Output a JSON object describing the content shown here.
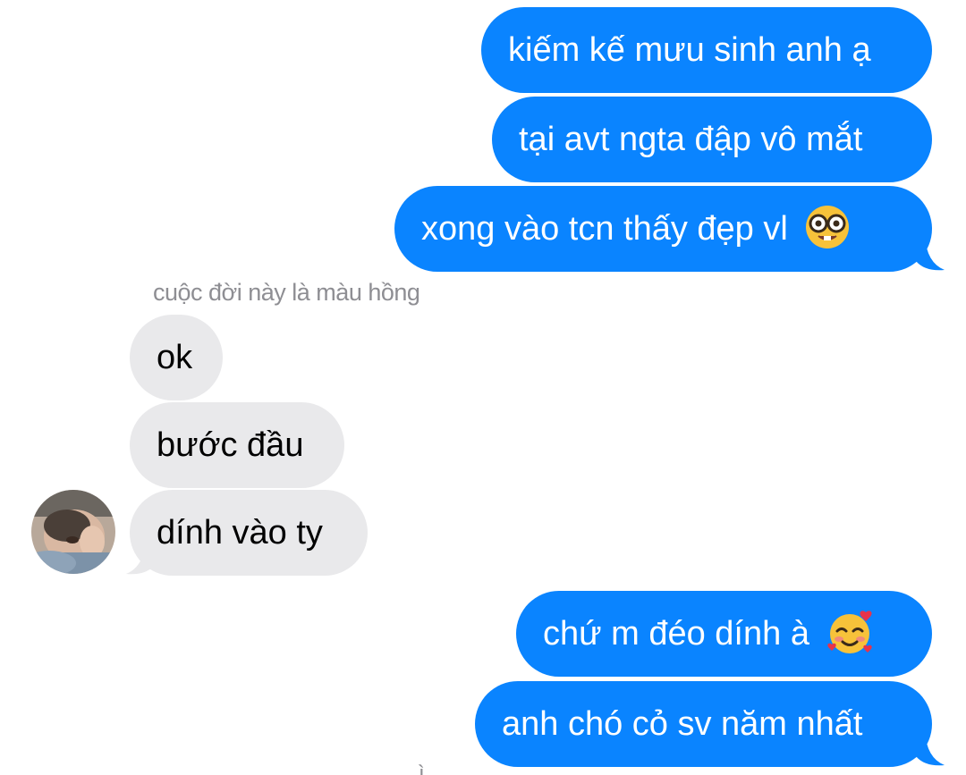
{
  "conversation": {
    "messages": [
      {
        "direction": "outgoing",
        "text": "kiếm kế mưu sinh anh ạ"
      },
      {
        "direction": "outgoing",
        "text": "tại avt ngta đập vô mắt"
      },
      {
        "direction": "outgoing",
        "text": "xong vào tcn thấy đẹp vl",
        "emoji": "nerd-face-icon"
      },
      {
        "direction": "incoming",
        "text": "ok"
      },
      {
        "direction": "incoming",
        "text": "bước đầu"
      },
      {
        "direction": "incoming",
        "text": "dính vào ty"
      },
      {
        "direction": "outgoing",
        "text": "chứ m đéo dính à",
        "emoji": "smiling-face-with-hearts-icon"
      },
      {
        "direction": "outgoing",
        "text": "anh chó cỏ sv năm nhất"
      }
    ],
    "sender_name": "cuộc đời này là màu hồng",
    "cutoff_text": "ì"
  },
  "colors": {
    "outgoing_bubble": "#0a84ff",
    "incoming_bubble": "#e9e9eb",
    "sender_label": "#8e8e93"
  }
}
